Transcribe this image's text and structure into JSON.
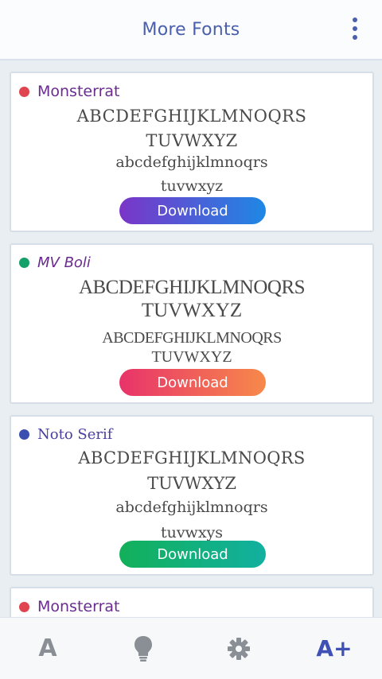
{
  "appbar": {
    "title": "More Fonts"
  },
  "cards": [
    {
      "name": "Monsterrat",
      "dot_color": "#e0454f",
      "name_color": "#6a2b8f",
      "lines": [
        "ABCDEFGHIJKLMNOQRS",
        "TUVWXYZ",
        "abcdefghijklmnoqrs",
        "tuvwxyz"
      ],
      "button_label": "Download",
      "button_gradient": [
        "#7b35c8",
        "#1e88e5"
      ]
    },
    {
      "name": "MV Boli",
      "dot_color": "#14a06a",
      "name_color": "#6a2b8f",
      "lines": [
        "ABCDEFGHIJKLMNOQRS",
        "TUVWXYZ",
        "ABCDEFGHIJKLMNOQRS",
        "TUVWXYZ"
      ],
      "button_label": "Download",
      "button_gradient": [
        "#e8336a",
        "#f7894a"
      ]
    },
    {
      "name": "Noto Serif",
      "dot_color": "#3b4fb0",
      "name_color": "#4a3ea0",
      "lines": [
        "ABCDEFGHIJKLMNOQRS",
        "TUVWXYZ",
        "abcdefghijklmnoqrs",
        "tuvwxys"
      ],
      "button_label": "Download",
      "button_gradient": [
        "#12b05a",
        "#12b0a0"
      ]
    },
    {
      "name": "Monsterrat",
      "dot_color": "#e0454f",
      "name_color": "#6a2b8f"
    }
  ],
  "nav": {
    "fonts_label": "A",
    "more_fonts_label": "A+",
    "accent": "#3f51b5",
    "inactive": "#8a8f96"
  }
}
